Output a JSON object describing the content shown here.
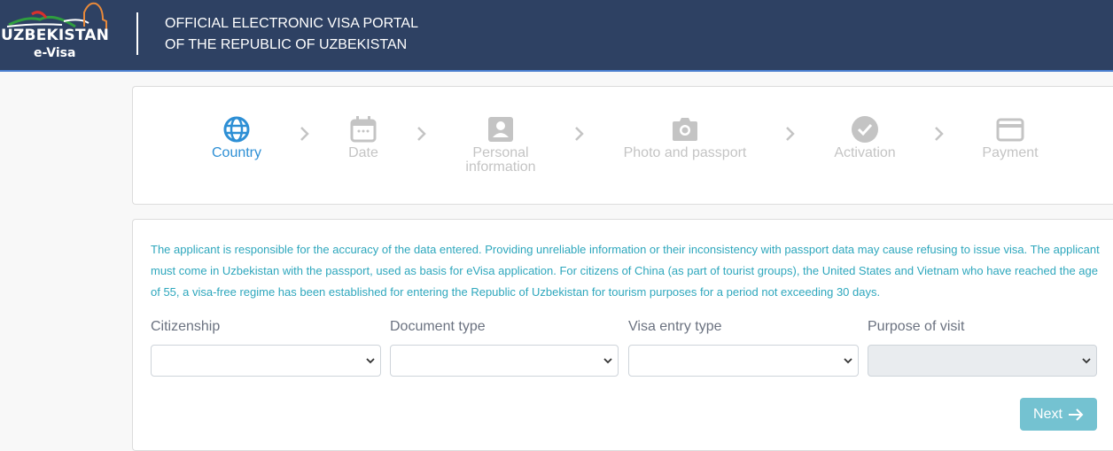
{
  "header": {
    "logo_word": "UZBEKISTAN",
    "logo_sub": "e-Visa",
    "title_line1": "OFFICIAL ELECTRONIC VISA PORTAL",
    "title_line2": "OF THE REPUBLIC OF UZBEKISTAN"
  },
  "steps": [
    {
      "label": "Country",
      "icon": "globe-icon",
      "active": true
    },
    {
      "label": "Date",
      "icon": "calendar-icon",
      "active": false
    },
    {
      "label": "Personal information",
      "icon": "person-icon",
      "active": false
    },
    {
      "label": "Photo and passport",
      "icon": "camera-icon",
      "active": false
    },
    {
      "label": "Activation",
      "icon": "check-circle-icon",
      "active": false
    },
    {
      "label": "Payment",
      "icon": "credit-card-icon",
      "active": false
    }
  ],
  "form": {
    "notice": "The applicant is responsible for the accuracy of the data entered. Providing unreliable information or their inconsistency with passport data may cause refusing to issue visa. The applicant must come in Uzbekistan with the passport, used as basis for eVisa application. For citizens of China (as part of tourist groups), the United States and Vietnam who have reached the age of 55, a visa-free regime has been established for entering the Republic of Uzbekistan for tourism purposes for a period not exceeding 30 days.",
    "fields": [
      {
        "label": "Citizenship",
        "value": "",
        "disabled": false
      },
      {
        "label": "Document type",
        "value": "",
        "disabled": false
      },
      {
        "label": "Visa entry type",
        "value": "",
        "disabled": false
      },
      {
        "label": "Purpose of visit",
        "value": "",
        "disabled": true
      }
    ],
    "next_label": "Next"
  },
  "colors": {
    "header_bg": "#2e4163",
    "active_step": "#2d8fd5",
    "inactive_step": "#c4c4c4",
    "notice_text": "#2ea7bd",
    "next_button": "#74c2d1"
  }
}
